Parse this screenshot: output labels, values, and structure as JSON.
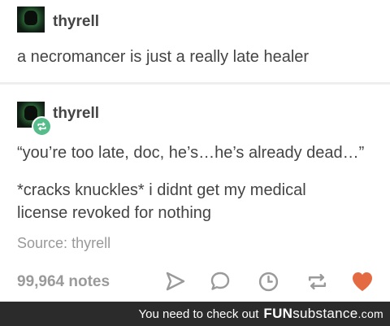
{
  "original_post": {
    "author": "thyrell",
    "text": "a necromancer is just a really late healer"
  },
  "reblog": {
    "author": "thyrell",
    "quote": "“you’re too late, doc, he’s…he’s already dead…”",
    "reply_line1": "*cracks knuckles* i didnt get my medical",
    "reply_line2": "license revoked for nothing",
    "source_label": "Source:",
    "source_name": "thyrell"
  },
  "footer": {
    "notes": "99,964 notes",
    "actions": [
      "share-icon",
      "reply-icon",
      "history-icon",
      "reblog-icon",
      "like-icon"
    ],
    "like_color": "#e46a42"
  },
  "banner": {
    "text": "You need to check out",
    "brand_bold": "FUN",
    "brand_rest": "substance",
    "brand_tld": ".com"
  },
  "colors": {
    "text": "#444444",
    "muted": "#999999",
    "reblog_badge": "#56bc8a",
    "banner_bg": "#2b2b2b"
  }
}
